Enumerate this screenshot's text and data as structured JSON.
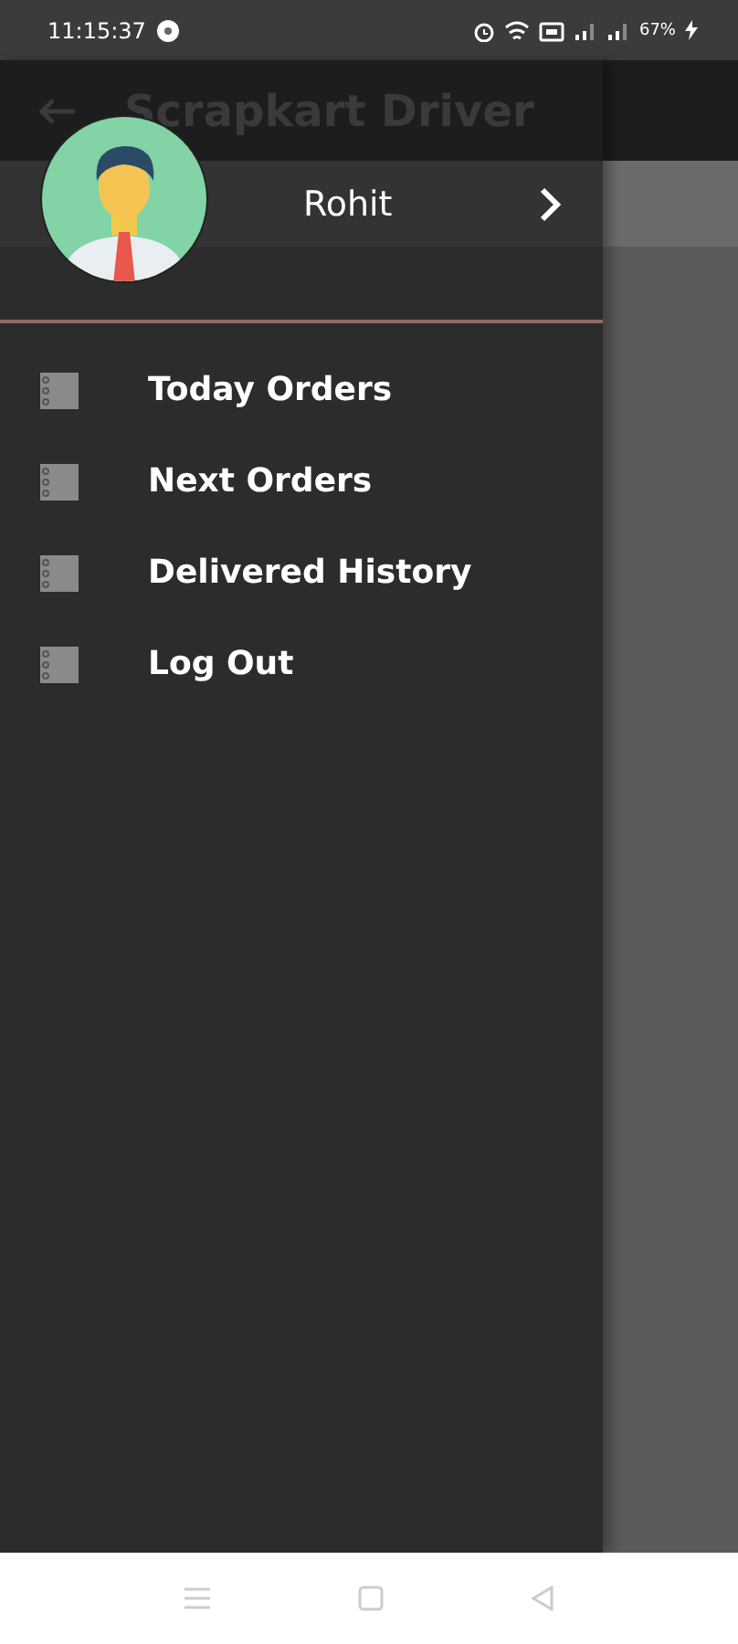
{
  "status_bar": {
    "time": "11:15:37",
    "battery": "67%"
  },
  "app_bar": {
    "title": "Scrapkart Driver"
  },
  "drawer": {
    "user": {
      "name": "Rohit"
    },
    "items": [
      {
        "label": "Today Orders"
      },
      {
        "label": "Next Orders"
      },
      {
        "label": "Delivered History"
      },
      {
        "label": "Log Out"
      }
    ]
  }
}
